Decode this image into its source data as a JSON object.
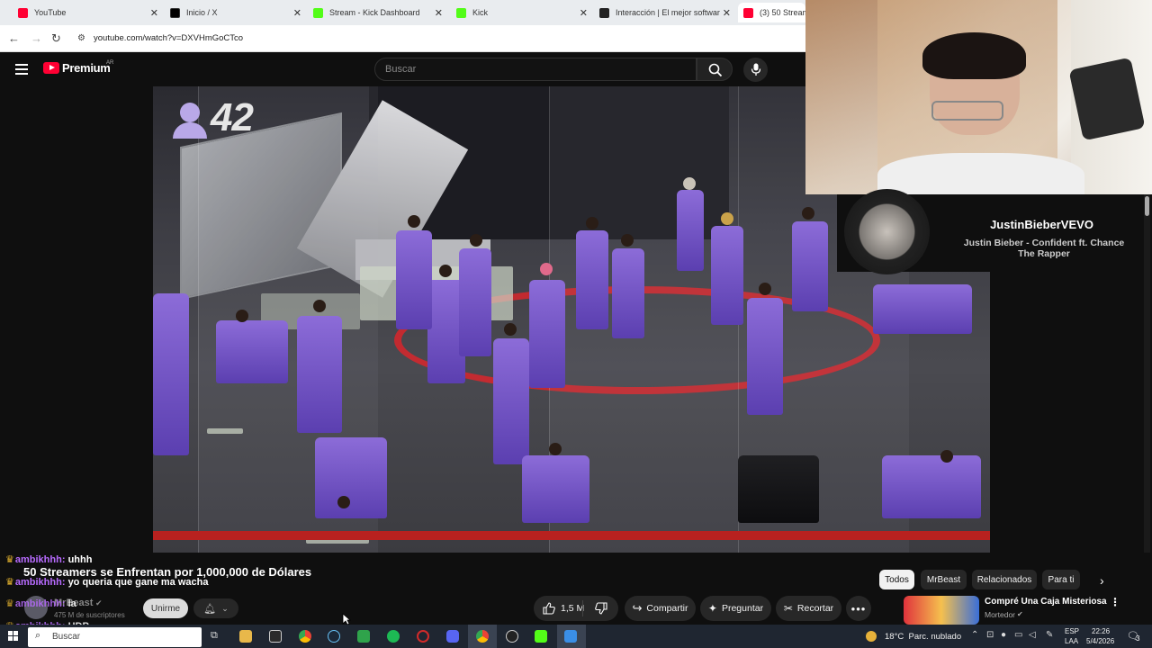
{
  "browser": {
    "tabs": [
      {
        "title": "YouTube",
        "color": "#ff0033",
        "active": false
      },
      {
        "title": "Inicio / X",
        "color": "#000000",
        "active": false
      },
      {
        "title": "Stream - Kick Dashboard",
        "color": "#53fc18",
        "active": false
      },
      {
        "title": "Kick",
        "color": "#53fc18",
        "active": false
      },
      {
        "title": "Interacción | El mejor software",
        "color": "#1a1a1a",
        "active": false
      },
      {
        "title": "(3) 50 Streamer",
        "color": "#ff0033",
        "active": true
      }
    ],
    "url": "youtube.com/watch?v=DXVHmGoCTco"
  },
  "youtube": {
    "logo": "Premium",
    "region": "AR",
    "search_placeholder": "Buscar",
    "video_title": "50 Streamers se Enfrentan por 1,000,000 de Dólares",
    "channel": {
      "name": "MrBeast",
      "subscribers": "475 M de suscriptores"
    },
    "join_label": "Unirme",
    "likes": "1,5 M",
    "share_label": "Compartir",
    "ask_label": "Preguntar",
    "clip_label": "Recortar",
    "overlay_counter": "42",
    "chips": [
      "Todos",
      "MrBeast",
      "Relacionados",
      "Para ti"
    ],
    "recommended": {
      "title": "Compré Una Caja Misteriosa",
      "channel": "Mortedor"
    }
  },
  "now_playing": {
    "artist": "JustinBieberVEVO",
    "song": "Justin Bieber - Confident ft. Chance The Rapper"
  },
  "chat": [
    {
      "user": "ambikhhh:",
      "message": "uhhh"
    },
    {
      "user": "ambikhhh:",
      "message": "yo queria que gane ma wacha"
    },
    {
      "user": "ambikhhh:",
      "message": "la"
    },
    {
      "user": "ambikhhh:",
      "message": "HDP"
    }
  ],
  "taskbar": {
    "search": "Buscar",
    "weather": "18°C  Parc. nublado",
    "lang1": "ESP",
    "lang2": "LAA",
    "time": "22:26",
    "date": "5/4/2026",
    "notifications": "3"
  }
}
